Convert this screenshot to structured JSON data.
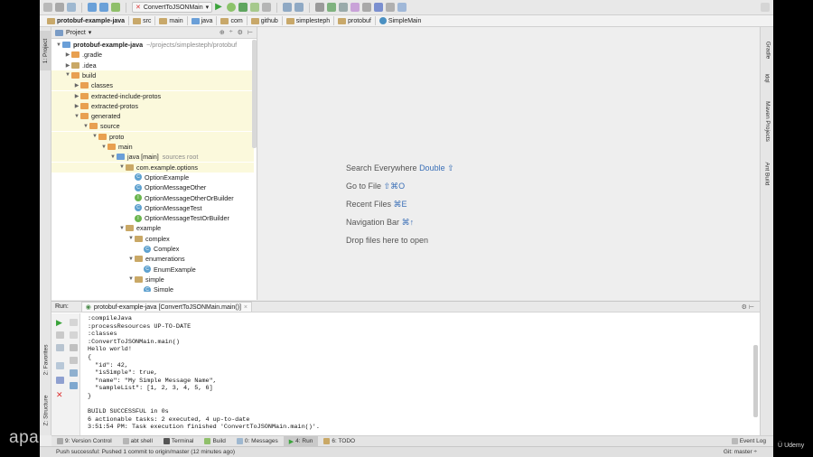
{
  "toolbar": {
    "run_config": "ConvertToJSONMain"
  },
  "breadcrumbs": [
    "protobuf-example-java",
    "src",
    "main",
    "java",
    "com",
    "github",
    "simplesteph",
    "protobuf",
    "SimpleMain"
  ],
  "left_stripe": {
    "project_tab": "1: Project",
    "favorites_tab": "2: Favorites",
    "structure_tab": "Z: Structure"
  },
  "right_stripe": {
    "gradle_tab": "Gradle",
    "idql_tab": "idql",
    "maven_tab": "Maven Projects",
    "ant_tab": "Ant Build"
  },
  "project_panel": {
    "title": "Project",
    "tree": [
      {
        "label": "protobuf-example-java",
        "extra": "~/projects/simplesteph/protobuf",
        "depth": 0,
        "arrow": "▼",
        "icon": "folder-blue"
      },
      {
        "label": ".gradle",
        "depth": 1,
        "arrow": "▶",
        "icon": "folder-orange"
      },
      {
        "label": ".idea",
        "depth": 1,
        "arrow": "▶",
        "icon": "folder"
      },
      {
        "label": "build",
        "depth": 1,
        "arrow": "▼",
        "icon": "folder-orange"
      },
      {
        "label": "classes",
        "depth": 2,
        "arrow": "▶",
        "icon": "folder-orange"
      },
      {
        "label": "extracted-include-protos",
        "depth": 2,
        "arrow": "▶",
        "icon": "folder-orange"
      },
      {
        "label": "extracted-protos",
        "depth": 2,
        "arrow": "▶",
        "icon": "folder-orange"
      },
      {
        "label": "generated",
        "depth": 2,
        "arrow": "▼",
        "icon": "folder-orange"
      },
      {
        "label": "source",
        "depth": 3,
        "arrow": "▼",
        "icon": "folder-orange"
      },
      {
        "label": "proto",
        "depth": 4,
        "arrow": "▼",
        "icon": "folder-orange"
      },
      {
        "label": "main",
        "depth": 5,
        "arrow": "▼",
        "icon": "folder-orange"
      },
      {
        "label": "java [main]",
        "extra": "sources root",
        "depth": 6,
        "arrow": "▼",
        "icon": "folder-blue"
      },
      {
        "label": "com.example.options",
        "depth": 7,
        "arrow": "▼",
        "icon": "folder"
      },
      {
        "label": "OptionExample",
        "depth": 8,
        "arrow": "",
        "icon": "class"
      },
      {
        "label": "OptionMessageOther",
        "depth": 8,
        "arrow": "",
        "icon": "class"
      },
      {
        "label": "OptionMessageOtherOrBuilder",
        "depth": 8,
        "arrow": "",
        "icon": "interface"
      },
      {
        "label": "OptionMessageTest",
        "depth": 8,
        "arrow": "",
        "icon": "class"
      },
      {
        "label": "OptionMessageTestOrBuilder",
        "depth": 8,
        "arrow": "",
        "icon": "interface"
      },
      {
        "label": "example",
        "depth": 7,
        "arrow": "▼",
        "icon": "folder"
      },
      {
        "label": "complex",
        "depth": 8,
        "arrow": "▼",
        "icon": "folder"
      },
      {
        "label": "Complex",
        "depth": 9,
        "arrow": "",
        "icon": "class"
      },
      {
        "label": "enumerations",
        "depth": 8,
        "arrow": "▼",
        "icon": "folder"
      },
      {
        "label": "EnumExample",
        "depth": 9,
        "arrow": "",
        "icon": "class"
      },
      {
        "label": "simple",
        "depth": 8,
        "arrow": "▼",
        "icon": "folder"
      },
      {
        "label": "Simple",
        "depth": 9,
        "arrow": "",
        "icon": "class"
      }
    ]
  },
  "editor_hints": [
    {
      "text": "Search Everywhere",
      "shortcut": "Double ⇧"
    },
    {
      "text": "Go to File",
      "shortcut": "⇧⌘O"
    },
    {
      "text": "Recent Files",
      "shortcut": "⌘E"
    },
    {
      "text": "Navigation Bar",
      "shortcut": "⌘↑"
    },
    {
      "text": "Drop files here to open",
      "shortcut": ""
    }
  ],
  "run_panel": {
    "label": "Run:",
    "tab": "protobuf-example-java [ConvertToJSONMain.main()]",
    "console": [
      ":compileJava",
      ":processResources UP-TO-DATE",
      ":classes",
      ":ConvertToJSONMain.main()",
      "Hello world!",
      "{",
      "  \"id\": 42,",
      "  \"isSimple\": true,",
      "  \"name\": \"My Simple Message Name\",",
      "  \"sampleList\": [1, 2, 3, 4, 5, 6]",
      "}",
      "",
      "BUILD SUCCESSFUL in 0s",
      "6 actionable tasks: 2 executed, 4 up-to-date",
      "3:51:54 PM: Task execution finished 'ConvertToJSONMain.main()'."
    ]
  },
  "tool_windows": [
    {
      "label": "9: Version Control",
      "active": false
    },
    {
      "label": "abt shell",
      "active": false
    },
    {
      "label": "Terminal",
      "active": false
    },
    {
      "label": "Build",
      "active": false
    },
    {
      "label": "0: Messages",
      "active": false
    },
    {
      "label": "4: Run",
      "active": true
    },
    {
      "label": "6: TODO",
      "active": false
    }
  ],
  "event_log": "Event Log",
  "status": {
    "message": "Push successful: Pushed 1 commit to origin/master (12 minutes ago)",
    "git": "Git: master ÷"
  },
  "watermarks": {
    "left": "apa",
    "right": "Udemy"
  },
  "colors": {
    "accent_blue": "#3a6fb7",
    "run_green": "#3aa33a",
    "highlight": "#fbf9dc"
  }
}
